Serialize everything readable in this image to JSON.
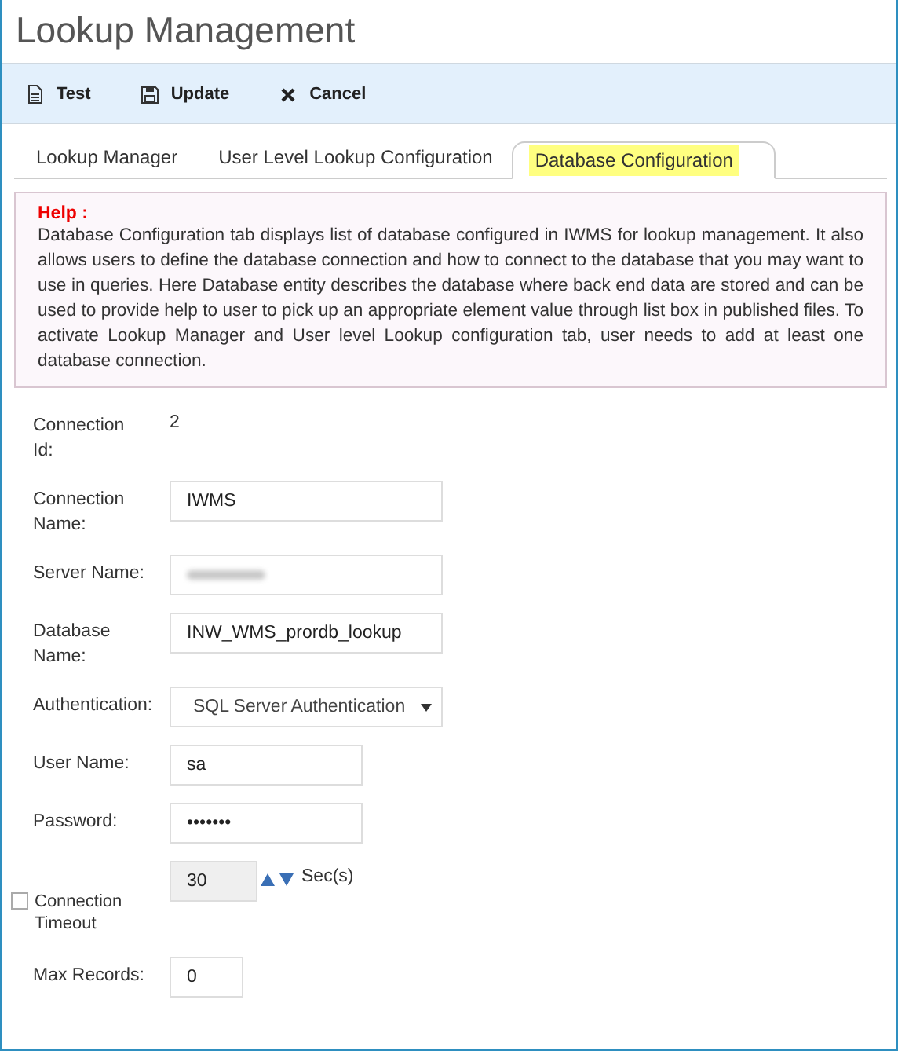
{
  "window": {
    "title": "Lookup Management"
  },
  "toolbar": [
    {
      "kind": "document",
      "label": "Test"
    },
    {
      "kind": "save",
      "label": "Update"
    },
    {
      "kind": "cancel",
      "label": "Cancel"
    }
  ],
  "tabs": [
    {
      "label": "Lookup Manager",
      "selected": false
    },
    {
      "label": "User Level Lookup Configuration",
      "selected": false
    },
    {
      "label": "Database Configuration",
      "selected": true
    }
  ],
  "help": {
    "title": "Help :",
    "text": "Database Configuration tab displays list of database configured in IWMS for lookup management. It also allows users to define the database connection and how to connect to the database that you may want to use in queries. Here Database entity describes the database where back end data are stored and can be used to provide help to user to pick up an appropriate element value through list box in published files. To activate Lookup Manager and User level Lookup configuration tab, user needs to add at least one database connection."
  },
  "form": [
    {
      "kind": "static",
      "label": "Connection Id:",
      "value": "2"
    },
    {
      "kind": "text",
      "label": "Connection Name:",
      "value": "IWMS"
    },
    {
      "kind": "redacted",
      "label": "Server Name:"
    },
    {
      "kind": "text",
      "label": "Database Name:",
      "value": "INW_WMS_prordb_lookup"
    },
    {
      "kind": "select",
      "label": "Authentication:",
      "value": "SQL Server Authentication"
    },
    {
      "kind": "short",
      "label": "User Name:",
      "value": "sa"
    },
    {
      "kind": "short",
      "label": "Password:",
      "value": "•••••••"
    },
    {
      "kind": "timeout",
      "label": "Connection Timeout",
      "checked": false,
      "disabled": true,
      "value": "30",
      "unit": "Sec(s)"
    },
    {
      "kind": "tiny",
      "label": "Max Records:",
      "value": "0"
    }
  ]
}
